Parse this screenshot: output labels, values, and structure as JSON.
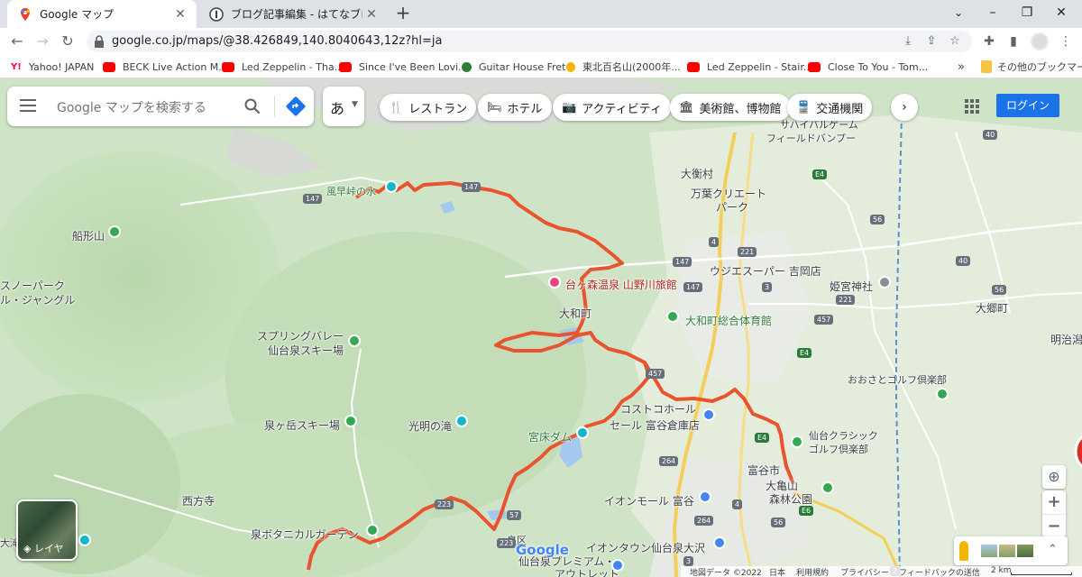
{
  "browser": {
    "tabs": [
      {
        "title": "Google マップ",
        "active": true
      },
      {
        "title": "ブログ記事編集 - はてなブログ",
        "active": false
      }
    ],
    "new_tab_label": "+",
    "url": "google.co.jp/maps/@38.426849,140.8040643,12z?hl=ja",
    "window_controls": {
      "minimize": "–",
      "restore": "❐",
      "close": "✕"
    }
  },
  "bookmarks": [
    {
      "label": "Yahoo! JAPAN",
      "color": "#ff0033"
    },
    {
      "label": "BECK Live Action M...",
      "color": "#ff0000"
    },
    {
      "label": "Led Zeppelin - Tha...",
      "color": "#ff0000"
    },
    {
      "label": "Since I've Been Lovi...",
      "color": "#ff0000"
    },
    {
      "label": "Guitar House Fret",
      "color": "#2e7d32"
    },
    {
      "label": "東北百名山(2000年...",
      "color": "#f4b400"
    },
    {
      "label": "Led Zeppelin - Stair...",
      "color": "#ff0000"
    },
    {
      "label": "Close To You - Tom...",
      "color": "#ff0000"
    }
  ],
  "bookmarks_more": "»",
  "other_bookmarks": "その他のブックマーク",
  "maps": {
    "search_placeholder": "Google マップを検索する",
    "ime_label": "あ",
    "chips": [
      {
        "label": "レストラン",
        "icon": "🍴"
      },
      {
        "label": "ホテル",
        "icon": "🛏"
      },
      {
        "label": "アクティビティ",
        "icon": "📷"
      },
      {
        "label": "美術館、博物館",
        "icon": "🏛"
      },
      {
        "label": "交通機関",
        "icon": "🚆"
      }
    ],
    "login_label": "ログイン",
    "layers_label": "レイヤ",
    "zoom_in": "+",
    "zoom_out": "−",
    "google_logo": "Google",
    "footer": {
      "map_data": "地図データ ©2022",
      "country": "日本",
      "terms": "利用規約",
      "privacy": "プライバシー",
      "feedback": "フィードバックの送信",
      "scale": "2 km"
    },
    "labels": [
      {
        "text": "サハイバルゲーム"
      },
      {
        "text": "フィールドバンプー"
      },
      {
        "text": "大衡村"
      },
      {
        "text": "万葉クリエート"
      },
      {
        "text": "パーク"
      },
      {
        "text": "風早峠の水"
      },
      {
        "text": "船形山"
      },
      {
        "text": "スノーパーク"
      },
      {
        "text": "ル・ジャングル"
      },
      {
        "text": "ウジエスーパー 吉岡店"
      },
      {
        "text": "姫宮神社"
      },
      {
        "text": "台ヶ森温泉 山野川旅館"
      },
      {
        "text": "大和町"
      },
      {
        "text": "大和町総合体育館"
      },
      {
        "text": "大郷町"
      },
      {
        "text": "明治潟"
      },
      {
        "text": "スプリングバレー"
      },
      {
        "text": "仙台泉スキー場"
      },
      {
        "text": "おおさとゴルフ倶楽部"
      },
      {
        "text": "コストコホール"
      },
      {
        "text": "セール 富谷倉庫店"
      },
      {
        "text": "泉ヶ岳スキー場"
      },
      {
        "text": "光明の滝"
      },
      {
        "text": "宮床ダム"
      },
      {
        "text": "仙台クラシック"
      },
      {
        "text": "ゴルフ倶楽部"
      },
      {
        "text": "富谷市"
      },
      {
        "text": "大亀山"
      },
      {
        "text": "森林公園"
      },
      {
        "text": "西方寺"
      },
      {
        "text": "イオンモール 富谷"
      },
      {
        "text": "泉ボタニカルガーデン"
      },
      {
        "text": "イオンタウン仙台泉大沢"
      },
      {
        "text": "仙台泉プレミアム・"
      },
      {
        "text": "アウトレット"
      },
      {
        "text": "泉区"
      },
      {
        "text": "大滝"
      }
    ],
    "road_shields": [
      "147",
      "147",
      "147",
      "4",
      "221",
      "40",
      "40",
      "56",
      "56",
      "3",
      "147",
      "221",
      "E4",
      "E4",
      "E4",
      "457",
      "457",
      "264",
      "264",
      "223",
      "223",
      "E6",
      "56",
      "4",
      "57",
      "3",
      "2"
    ]
  }
}
